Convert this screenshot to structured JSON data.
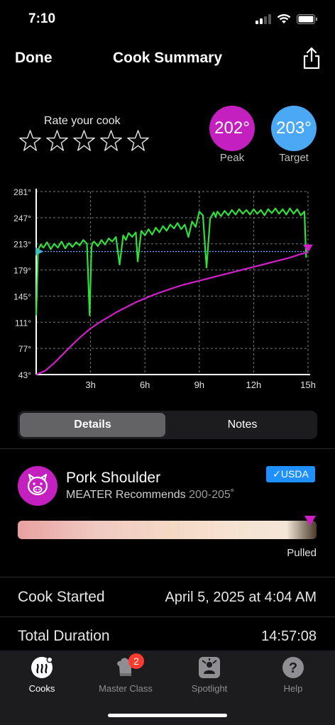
{
  "status": {
    "time": "7:10"
  },
  "nav": {
    "done_label": "Done",
    "title": "Cook Summary"
  },
  "rating": {
    "label": "Rate your cook",
    "stars": 5,
    "value": 0
  },
  "peak": {
    "value": "202°",
    "label": "Peak",
    "color": "#c41fbf"
  },
  "target": {
    "value": "203°",
    "label": "Target",
    "color": "#4aa8f5"
  },
  "chart_data": {
    "type": "line",
    "y_tick_labels": [
      "281°",
      "247°",
      "213°",
      "179°",
      "145°",
      "111°",
      "77°",
      "43°"
    ],
    "x_tick_labels": [
      "3h",
      "6h",
      "9h",
      "12h",
      "15h"
    ],
    "ylim": [
      43,
      281
    ],
    "xlim": [
      0,
      15
    ],
    "grid": true,
    "target_line": 203,
    "series": [
      {
        "color": "#2ee03a",
        "x": [
          0,
          0.1,
          0.25,
          0.4,
          0.6,
          0.8,
          1.0,
          1.2,
          1.4,
          1.6,
          1.8,
          2.0,
          2.2,
          2.4,
          2.6,
          2.8,
          2.95,
          3.05,
          3.1,
          3.2,
          3.4,
          3.6,
          3.8,
          4.0,
          4.2,
          4.4,
          4.6,
          4.8,
          4.95,
          5.1,
          5.3,
          5.5,
          5.6,
          5.8,
          6.0,
          6.2,
          6.4,
          6.6,
          6.8,
          7.0,
          7.2,
          7.4,
          7.6,
          7.8,
          8.0,
          8.2,
          8.4,
          8.6,
          8.8,
          9.0,
          9.2,
          9.4,
          9.6,
          9.8,
          9.9,
          10.0,
          10.2,
          10.4,
          10.6,
          10.8,
          11.0,
          11.2,
          11.4,
          11.6,
          11.8,
          12.0,
          12.2,
          12.4,
          12.6,
          12.8,
          13.0,
          13.2,
          13.4,
          13.6,
          13.8,
          14.0,
          14.2,
          14.4,
          14.6,
          14.8,
          14.9
        ],
        "y": [
          120,
          205,
          212,
          208,
          215,
          206,
          213,
          208,
          216,
          207,
          214,
          209,
          215,
          211,
          218,
          213,
          120,
          208,
          214,
          216,
          210,
          218,
          212,
          220,
          216,
          222,
          186,
          224,
          218,
          227,
          222,
          228,
          190,
          230,
          224,
          232,
          225,
          234,
          228,
          236,
          230,
          238,
          233,
          240,
          232,
          238,
          222,
          242,
          235,
          255,
          250,
          182,
          246,
          254,
          248,
          255,
          249,
          256,
          250,
          257,
          251,
          258,
          252,
          257,
          251,
          258,
          252,
          257,
          250,
          258,
          253,
          259,
          252,
          258,
          251,
          259,
          252,
          258,
          250,
          255,
          195
        ]
      },
      {
        "color": "#d01fc8",
        "x": [
          0,
          0.5,
          1,
          1.5,
          2,
          2.5,
          3,
          3.5,
          4,
          4.5,
          5,
          5.5,
          6,
          6.5,
          7,
          7.5,
          8,
          8.5,
          9,
          9.5,
          10,
          10.5,
          11,
          11.5,
          12,
          12.5,
          13,
          13.5,
          14,
          14.5,
          15
        ],
        "y": [
          43,
          48,
          58,
          70,
          82,
          93,
          103,
          111,
          118,
          125,
          131,
          137,
          142,
          147,
          151,
          155,
          159,
          162,
          165,
          168,
          171,
          174,
          177,
          180,
          183,
          186,
          189,
          192,
          195,
          199,
          202
        ]
      }
    ]
  },
  "segmented": {
    "details_label": "Details",
    "notes_label": "Notes"
  },
  "meat": {
    "name": "Pork Shoulder",
    "recommend_prefix": "MEATER Recommends",
    "recommend_range": "200-205˚",
    "badge": "✓USDA",
    "status": "Pulled",
    "doneness_level": 0.98
  },
  "details": [
    {
      "label": "Cook Started",
      "value": "April 5, 2025 at 4:04 AM"
    },
    {
      "label": "Total Duration",
      "value": "14:57:08"
    }
  ],
  "tabbar": {
    "cooks": "Cooks",
    "masterclass": "Master Class",
    "masterclass_badge": "2",
    "spotlight": "Spotlight",
    "help": "Help"
  }
}
